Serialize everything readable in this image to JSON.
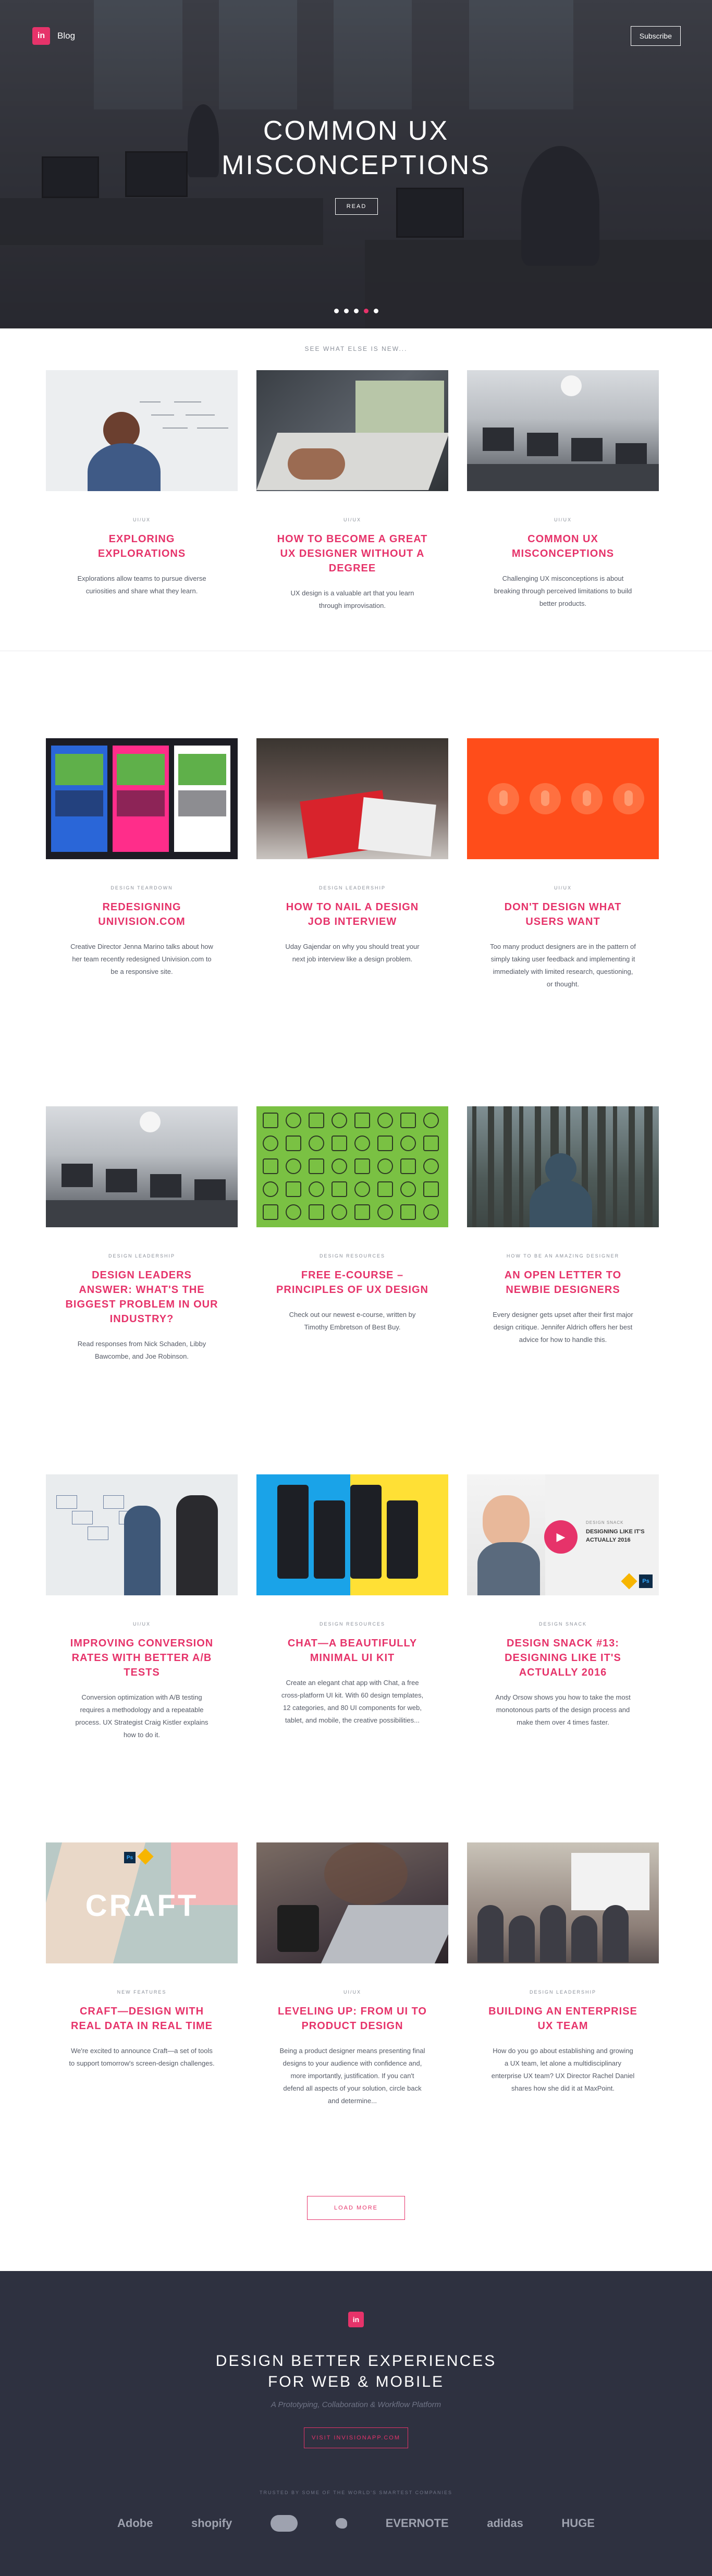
{
  "header": {
    "logo_text": "in",
    "blog_label": "Blog",
    "subscribe_label": "Subscribe"
  },
  "hero": {
    "title_line1": "COMMON UX",
    "title_line2": "MISCONCEPTIONS",
    "read_label": "READ",
    "slide_count": 5,
    "active_slide": 3
  },
  "section_label": "SEE WHAT ELSE IS NEW...",
  "posts": [
    {
      "category": "UI/UX",
      "title": "EXPLORING EXPLORATIONS",
      "desc": "Explorations allow teams to pursue diverse curiosities and share what they learn.",
      "thumb": "whiteboard"
    },
    {
      "category": "UI/UX",
      "title": "HOW TO BECOME A GREAT UX DESIGNER WITHOUT A DEGREE",
      "desc": "UX design is a valuable art that you learn through improvisation.",
      "thumb": "laptop"
    },
    {
      "category": "UI/UX",
      "title": "COMMON UX MISCONCEPTIONS",
      "desc": "Challenging UX misconceptions is about breaking through perceived limitations to build better products.",
      "thumb": "office"
    },
    {
      "category": "DESIGN TEARDOWN",
      "title": "REDESIGNING UNIVISION.COM",
      "desc": "Creative Director Jenna Marino talks about how her team recently redesigned Univision.com to be a responsive site.",
      "thumb": "univision"
    },
    {
      "category": "DESIGN LEADERSHIP",
      "title": "HOW TO NAIL A DESIGN JOB INTERVIEW",
      "desc": "Uday Gajendar on why you should treat your next job interview like a design problem.",
      "thumb": "books"
    },
    {
      "category": "UI/UX",
      "title": "DON'T DESIGN WHAT USERS WANT",
      "desc": "Too many product designers are in the pattern of simply taking user feedback and implementing it immediately with limited research, questioning, or thought.",
      "thumb": "red"
    },
    {
      "category": "DESIGN LEADERSHIP",
      "title": "DESIGN LEADERS ANSWER: WHAT'S THE BIGGEST PROBLEM IN OUR INDUSTRY?",
      "desc": "Read responses from Nick Schaden, Libby Bawcombe, and Joe Robinson.",
      "thumb": "office2"
    },
    {
      "category": "DESIGN RESOURCES",
      "title": "FREE E-COURSE – PRINCIPLES OF UX DESIGN",
      "desc": "Check out our newest e-course, written by Timothy Embretson of Best Buy.",
      "thumb": "icons"
    },
    {
      "category": "HOW TO BE AN AMAZING DESIGNER",
      "title": "AN OPEN LETTER TO NEWBIE DESIGNERS",
      "desc": "Every designer gets upset after their first major design critique. Jennifer Aldrich offers her best advice for how to handle this.",
      "thumb": "forest"
    },
    {
      "category": "UI/UX",
      "title": "IMPROVING CONVERSION RATES WITH BETTER A/B TESTS",
      "desc": "Conversion optimization with A/B testing requires a methodology and a repeatable process. UX Strategist Craig Kistler explains how to do it.",
      "thumb": "team"
    },
    {
      "category": "DESIGN RESOURCES",
      "title": "CHAT—A BEAUTIFULLY MINIMAL UI KIT",
      "desc": "Create an elegant chat app with Chat, a free cross-platform UI kit. With 60 design templates, 12 categories, and 80 UI components for web, tablet, and mobile, the creative possibilities...",
      "thumb": "phones"
    },
    {
      "category": "DESIGN SNACK",
      "title": "DESIGN SNACK #13: DESIGNING LIKE IT'S ACTUALLY 2016",
      "desc": "Andy Orsow shows you how to take the most monotonous parts of the design process and make them over 4 times faster.",
      "thumb": "video"
    },
    {
      "category": "NEW FEATURES",
      "title": "CRAFT—DESIGN WITH REAL DATA IN REAL TIME",
      "desc": "We're excited to announce Craft—a set of tools to support tomorrow's screen-design challenges.",
      "thumb": "craft"
    },
    {
      "category": "UI/UX",
      "title": "LEVELING UP: FROM UI TO PRODUCT DESIGN",
      "desc": "Being a product designer means presenting final designs to your audience with confidence and, more importantly, justification. If you can't defend all aspects of your solution, circle back and determine...",
      "thumb": "code"
    },
    {
      "category": "DESIGN LEADERSHIP",
      "title": "BUILDING AN ENTERPRISE UX TEAM",
      "desc": "How do you go about establishing and growing a UX team, let alone a multidisciplinary enterprise UX team? UX Director Rachel Daniel shares how she did it at MaxPoint.",
      "thumb": "meeting"
    }
  ],
  "video_thumb": {
    "tag": "DESIGN SNACK",
    "line1": "DESIGNING LIKE IT'S",
    "line2": "ACTUALLY 2016",
    "ps": "Ps"
  },
  "craft_thumb": {
    "word": "CRAFT",
    "ps": "Ps"
  },
  "load_more_label": "LOAD MORE",
  "footer": {
    "logo_text": "in",
    "title_line1": "DESIGN BETTER EXPERIENCES",
    "title_line2": "FOR WEB & MOBILE",
    "subtitle": "A Prototyping, Collaboration & Workflow Platform",
    "cta_label": "VISIT INVISIONAPP.COM",
    "trusted_label": "TRUSTED BY SOME OF THE WORLD'S SMARTEST COMPANIES",
    "brands": [
      "Adobe",
      "shopify",
      "Salesforce",
      "Twitter",
      "EVERNOTE",
      "adidas",
      "HUGE"
    ]
  },
  "colors": {
    "accent": "#e6336a",
    "footer_bg": "#2e3140",
    "hero_bg": "#3c3e44"
  }
}
